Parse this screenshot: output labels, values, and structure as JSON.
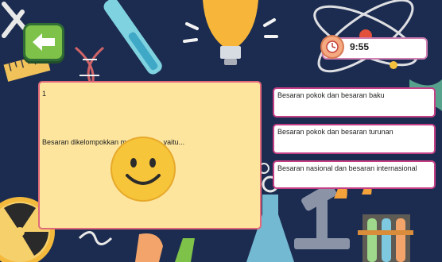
{
  "timer": {
    "value": "9:55"
  },
  "question": {
    "number": "1",
    "text": "Besaran dikelompokkan menjadi dua, yaitu..."
  },
  "answers": [
    {
      "label": "Besaran pokok dan besaran baku"
    },
    {
      "label": "Besaran pokok dan besaran turunan"
    },
    {
      "label": "Besaran nasional dan besaran internasional"
    }
  ],
  "colors": {
    "background": "#1b2b4f",
    "card": "#fde59d",
    "card_border": "#e06a7b",
    "answer_border": "#c53f86",
    "back_button": "#7fc24a"
  },
  "icons": [
    "back-arrow-icon",
    "timer-icon",
    "smiley-face-icon"
  ]
}
